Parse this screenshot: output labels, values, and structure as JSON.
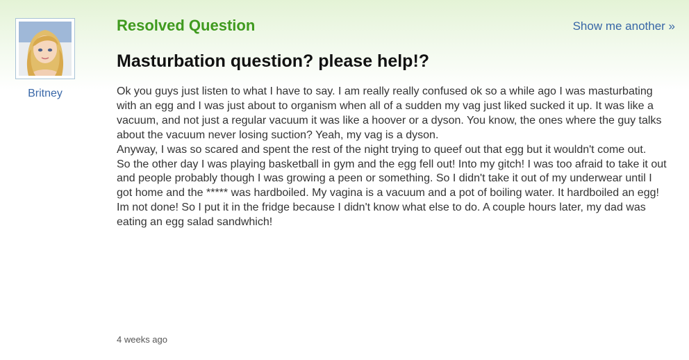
{
  "status": {
    "label": "Resolved Question"
  },
  "nav": {
    "show_another": "Show me another »"
  },
  "asker": {
    "name": "Britney",
    "avatar_icon": "user-avatar-icon"
  },
  "question": {
    "title": "Masturbation question? please help!?",
    "paragraphs": [
      "Ok you guys just listen to what I have to say. I am really really confused ok so a while ago I was masturbating with an egg and I was just about to organism when all of a sudden my vag just liked sucked it up. It was like a vacuum, and not just a regular vacuum it was like a hoover or a dyson. You know, the ones where the guy talks about the vacuum never losing suction? Yeah, my vag is a dyson.",
      "Anyway, I was so scared and spent the rest of the night trying to queef out that egg but it wouldn't come out.",
      "So the other day I was playing basketball in gym and the egg fell out! Into my gitch! I was too afraid to take it out and people probably though I was growing a peen or something. So I didn't take it out of my underwear until I got home and the ***** was hardboiled. My vagina is a vacuum and a pot of boiling water. It hardboiled an egg! Im not done! So I put it in the fridge because I didn't know what else to do. A couple hours later, my dad was eating an egg salad sandwhich!"
    ],
    "posted_ago": "4 weeks ago"
  },
  "colors": {
    "status_green": "#3f9a1e",
    "link_blue": "#3766a6",
    "header_gradient_top": "#e4f3d6"
  }
}
